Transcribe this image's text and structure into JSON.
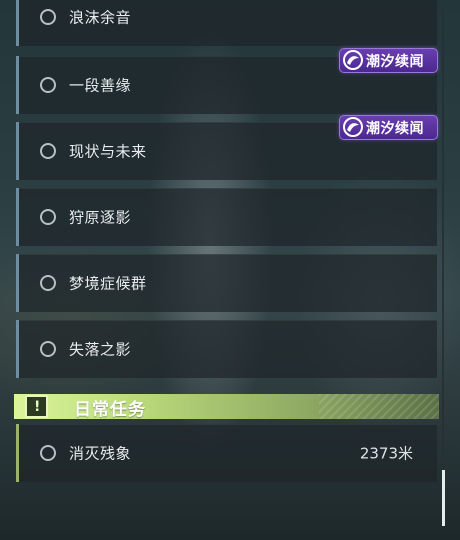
{
  "quests": [
    {
      "label": "浪沫余音",
      "badge": ""
    },
    {
      "label": "一段善缘",
      "badge": "潮汐续闻"
    },
    {
      "label": "现状与未来",
      "badge": "潮汐续闻"
    },
    {
      "label": "狩原逐影",
      "badge": ""
    },
    {
      "label": "梦境症候群",
      "badge": ""
    },
    {
      "label": "失落之影",
      "badge": ""
    }
  ],
  "daily_section": {
    "title": "日常任务",
    "icon": "exclamation-icon"
  },
  "daily_quests": [
    {
      "label": "消灭残象",
      "distance": "2373米"
    }
  ],
  "colors": {
    "quest_bar": "#6f8da0",
    "daily_accent": "#b9d97b",
    "badge_purple": "#5a34a0"
  },
  "scrollbar": {
    "position": 0.91
  }
}
